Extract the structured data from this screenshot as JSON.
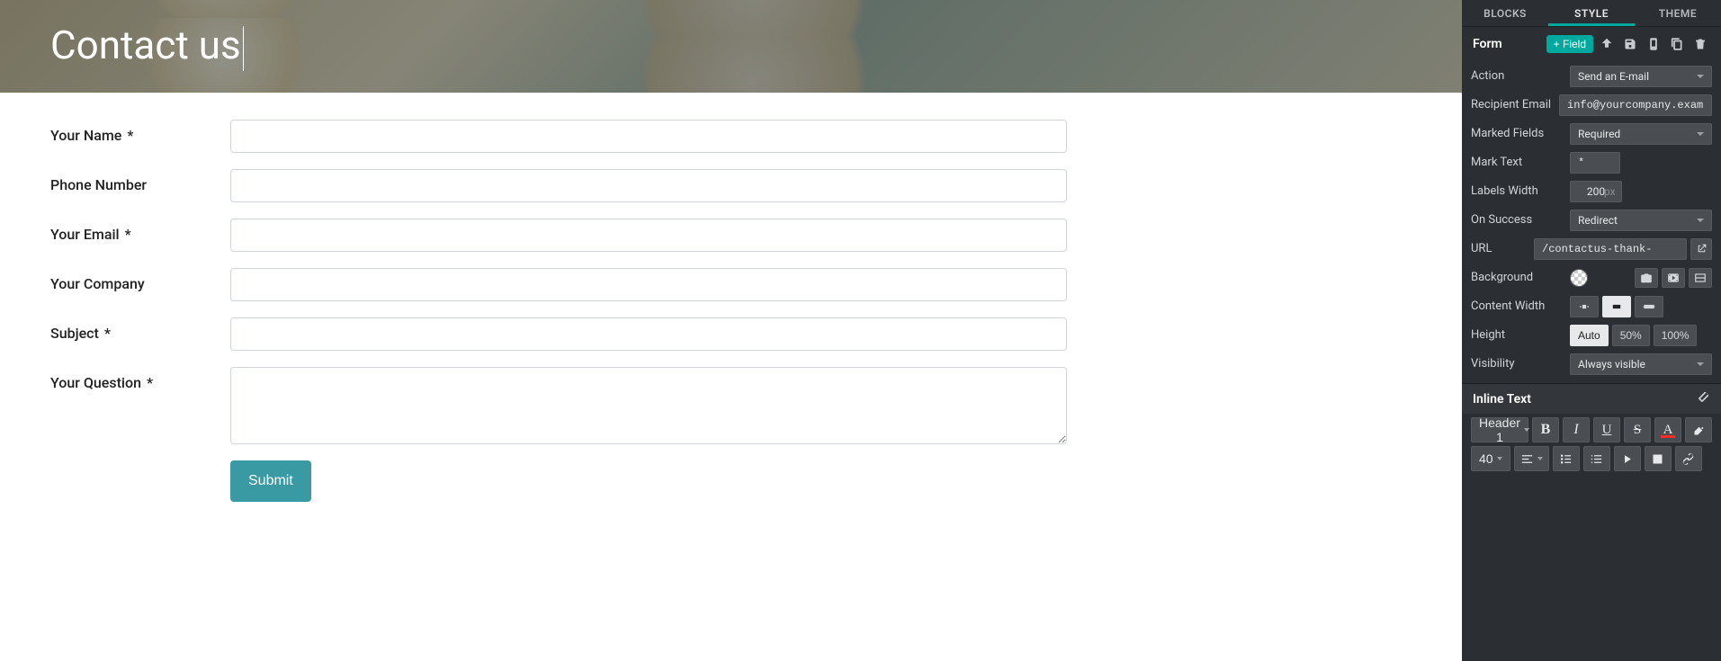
{
  "hero": {
    "title": "Contact us"
  },
  "form": {
    "fields": [
      {
        "label": "Your Name",
        "required": true,
        "type": "text"
      },
      {
        "label": "Phone Number",
        "required": false,
        "type": "text"
      },
      {
        "label": "Your Email",
        "required": true,
        "type": "text"
      },
      {
        "label": "Your Company",
        "required": false,
        "type": "text"
      },
      {
        "label": "Subject",
        "required": true,
        "type": "text"
      },
      {
        "label": "Your Question",
        "required": true,
        "type": "textarea"
      }
    ],
    "submit_label": "Submit",
    "required_mark": "*"
  },
  "sidebar": {
    "tabs": {
      "blocks": "BLOCKS",
      "style": "STYLE",
      "theme": "THEME",
      "active": "style"
    },
    "section_form": {
      "title": "Form",
      "add_field": "+ Field",
      "props": {
        "action": {
          "label": "Action",
          "value": "Send an E-mail"
        },
        "recipient": {
          "label": "Recipient Email",
          "value": "info@yourcompany.exam"
        },
        "marked_fields": {
          "label": "Marked Fields",
          "value": "Required"
        },
        "mark_text": {
          "label": "Mark Text",
          "value": "*"
        },
        "labels_width": {
          "label": "Labels Width",
          "value": "200",
          "unit": "px"
        },
        "on_success": {
          "label": "On Success",
          "value": "Redirect"
        },
        "url": {
          "label": "URL",
          "value": "/contactus-thank-"
        },
        "background": {
          "label": "Background"
        },
        "content_width": {
          "label": "Content Width",
          "options": [
            "narrow",
            "normal",
            "wide"
          ],
          "active": 1
        },
        "height": {
          "label": "Height",
          "options": [
            "Auto",
            "50%",
            "100%"
          ],
          "active": 0
        },
        "visibility": {
          "label": "Visibility",
          "value": "Always visible"
        }
      }
    },
    "section_inline": {
      "title": "Inline Text",
      "heading_select": "Header 1",
      "font_size": "40"
    }
  }
}
